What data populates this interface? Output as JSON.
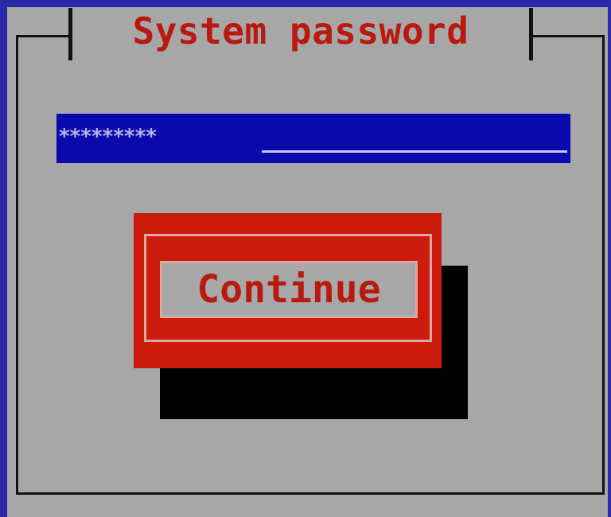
{
  "dialog": {
    "title": "System password"
  },
  "password_field": {
    "masked_value": "*********"
  },
  "continue_button": {
    "label": "Continue"
  },
  "colors": {
    "background": "#a7a7a7",
    "title_text": "#b81a10",
    "field_background": "#0909ad",
    "button_background": "#cc1a0c",
    "button_shadow": "#000000"
  }
}
